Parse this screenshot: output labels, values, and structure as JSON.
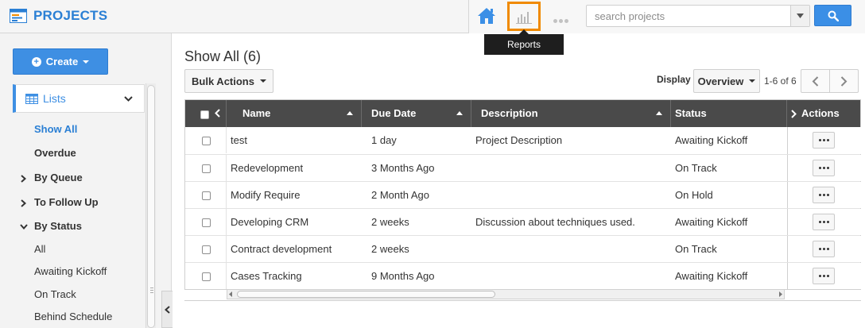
{
  "app": {
    "title": "PROJECTS"
  },
  "topbar": {
    "search_placeholder": "search projects",
    "reports_tooltip": "Reports",
    "accent_color": "#3e8fe3",
    "highlight_color": "#f08a00"
  },
  "sidebar": {
    "create_label": "Create",
    "lists_label": "Lists",
    "items": [
      {
        "label": "Show All",
        "active": true
      },
      {
        "label": "Overdue"
      },
      {
        "label": "By Queue",
        "expandable": true
      },
      {
        "label": "To Follow Up",
        "expandable": true
      },
      {
        "label": "By Status",
        "expanded": true
      },
      {
        "label": "All"
      },
      {
        "label": "Awaiting Kickoff"
      },
      {
        "label": "On Track"
      },
      {
        "label": "Behind Schedule"
      }
    ]
  },
  "main": {
    "title": "Show All (6)",
    "bulk_actions_label": "Bulk Actions",
    "display_label": "Display",
    "display_value": "Overview",
    "pager_text": "1-6 of 6"
  },
  "table": {
    "columns": {
      "name": "Name",
      "due_date": "Due Date",
      "description": "Description",
      "status": "Status",
      "actions": "Actions"
    },
    "rows": [
      {
        "name": "test",
        "due_date": "1 day",
        "description": "Project Description",
        "status": "Awaiting Kickoff"
      },
      {
        "name": "Redevelopment",
        "due_date": "3 Months Ago",
        "description": "",
        "status": "On Track"
      },
      {
        "name": "Modify Require",
        "due_date": "2 Month Ago",
        "description": "",
        "status": "On Hold"
      },
      {
        "name": "Developing CRM",
        "due_date": "2 weeks",
        "description": "Discussion about techniques used.",
        "status": "Awaiting Kickoff"
      },
      {
        "name": "Contract development",
        "due_date": "2 weeks",
        "description": "",
        "status": "On Track"
      },
      {
        "name": "Cases Tracking",
        "due_date": "9 Months Ago",
        "description": "",
        "status": "Awaiting Kickoff"
      }
    ]
  }
}
